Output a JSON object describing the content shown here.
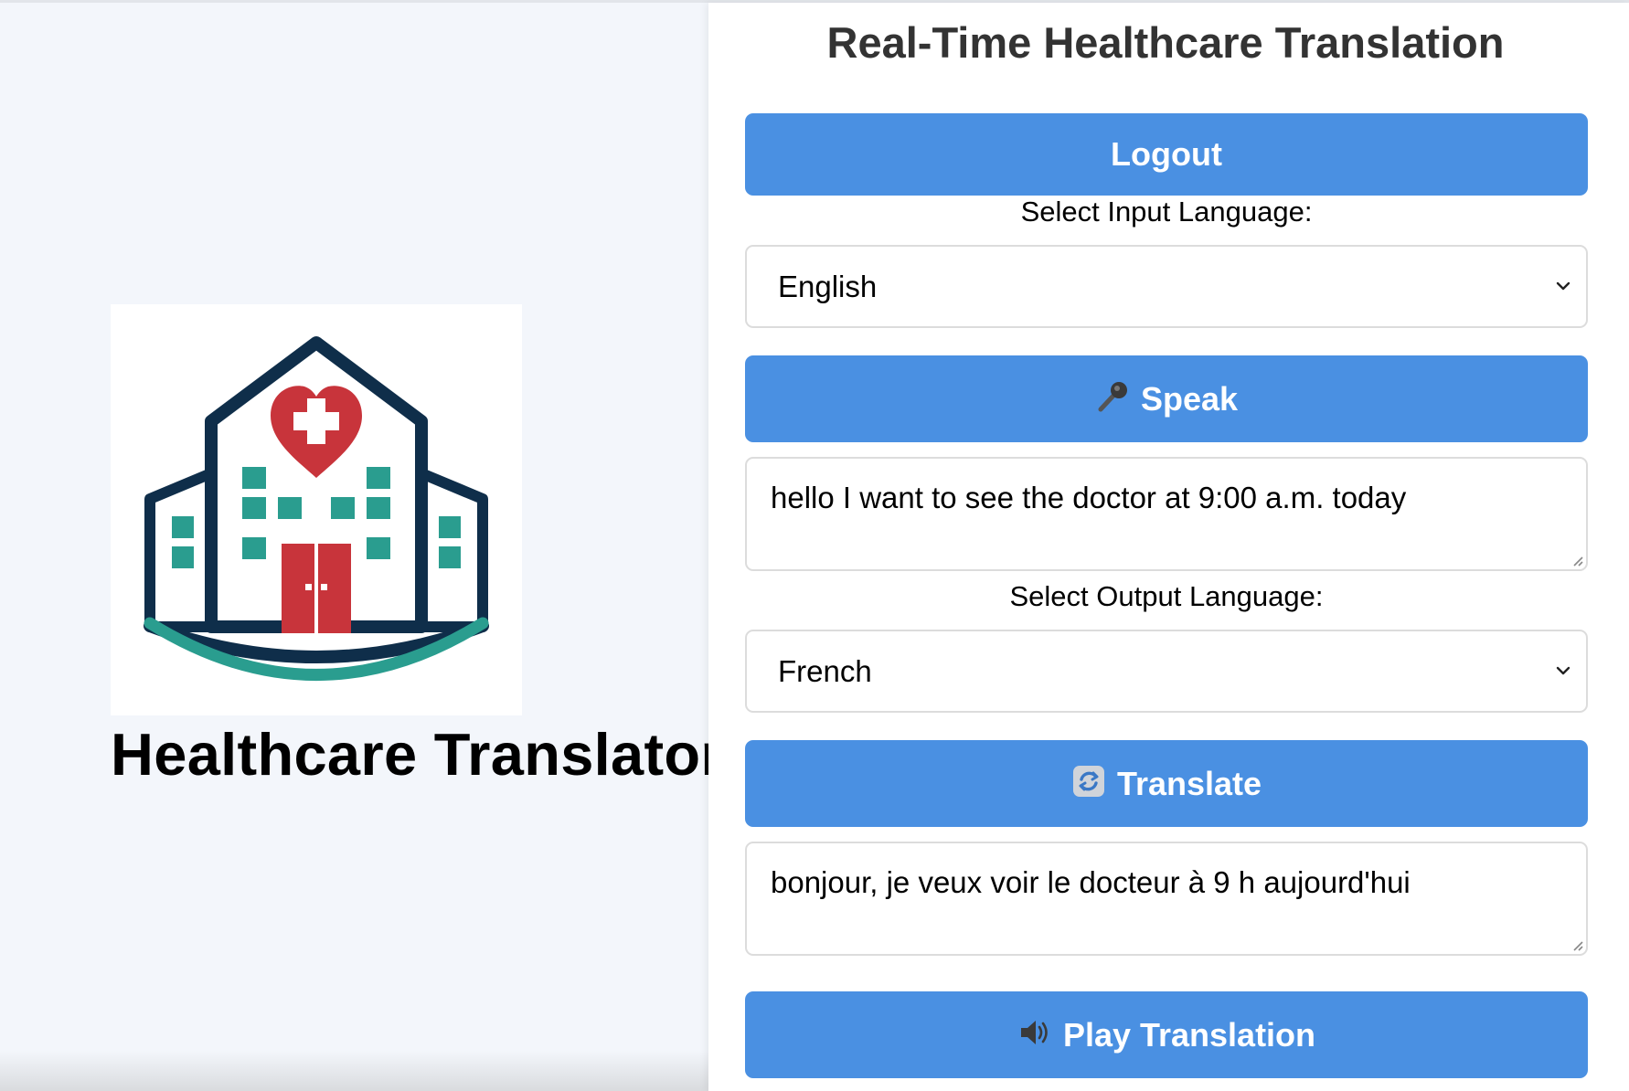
{
  "brand": {
    "title": "Healthcare Translator"
  },
  "header": {
    "title": "Real-Time Healthcare Translation"
  },
  "buttons": {
    "logout": "Logout",
    "speak": "Speak",
    "translate": "Translate",
    "play": "Play Translation"
  },
  "input": {
    "label": "Select Input Language:",
    "language": "English",
    "text": "hello I want to see the doctor at 9:00 a.m. today"
  },
  "output": {
    "label": "Select Output Language:",
    "language": "French",
    "text": "bonjour, je veux voir le docteur à 9 h aujourd'hui"
  },
  "icons": {
    "speak": "microphone-icon",
    "translate": "refresh-icon",
    "play": "speaker-icon"
  },
  "colors": {
    "accent": "#4a90e2",
    "logo_navy": "#0f2e4a",
    "logo_red": "#c8343b",
    "logo_teal": "#2a9d8f"
  }
}
